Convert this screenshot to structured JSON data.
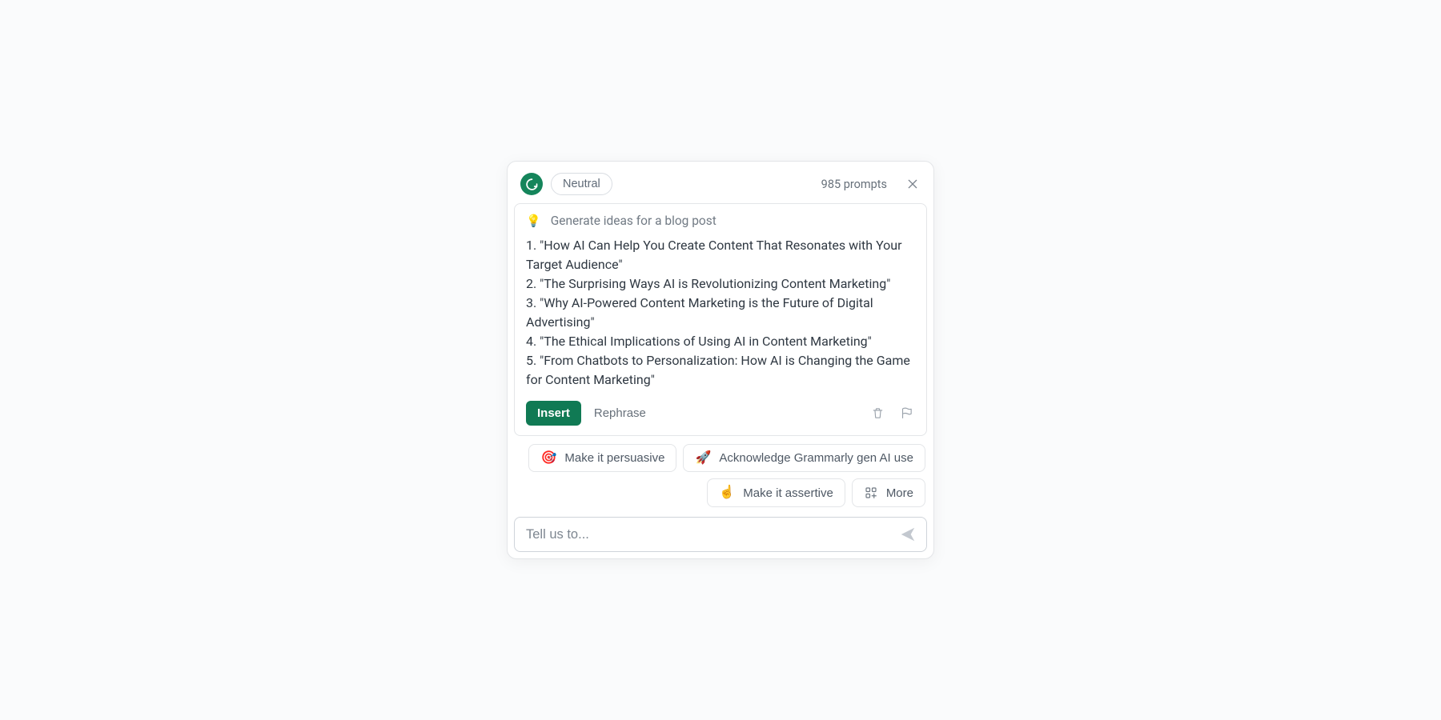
{
  "header": {
    "tone": "Neutral",
    "prompts_text": "985 prompts"
  },
  "card": {
    "icon": "💡",
    "title": "Generate ideas for a blog post",
    "ideas": [
      "1. \"How AI Can Help You Create Content That Resonates with Your Target Audience\"",
      "2. \"The Surprising Ways AI is Revolutionizing Content Marketing\"",
      "3. \"Why AI-Powered Content Marketing is the Future of Digital Advertising\"",
      "4. \"The Ethical Implications of Using AI in Content Marketing\"",
      "5. \"From Chatbots to Personalization: How AI is Changing the Game for Content Marketing\""
    ],
    "insert_label": "Insert",
    "rephrase_label": "Rephrase"
  },
  "suggestions": {
    "persuasive": {
      "icon": "🎯",
      "label": "Make it persuasive"
    },
    "acknowledge": {
      "icon": "🚀",
      "label": "Acknowledge Grammarly gen AI use"
    },
    "assertive": {
      "icon": "☝️",
      "label": "Make it assertive"
    },
    "more_label": "More"
  },
  "input": {
    "placeholder": "Tell us to..."
  }
}
